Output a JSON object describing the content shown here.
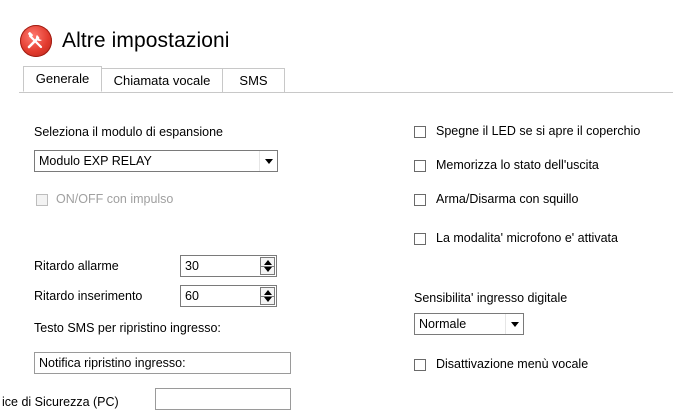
{
  "window": {
    "title": "Altre impostazioni",
    "icon": "tools-icon",
    "icon_color": "#e23b2e"
  },
  "tabs": [
    {
      "label": "Generale",
      "active": true
    },
    {
      "label": "Chiamata vocale",
      "active": false
    },
    {
      "label": "SMS",
      "active": false
    }
  ],
  "left": {
    "expansion_label": "Seleziona il modulo di espansione",
    "expansion_value": "Modulo EXP RELAY",
    "impulse_label": "ON/OFF con impulso",
    "impulse_checked": false,
    "impulse_enabled": false,
    "alarm_delay_label": "Ritardo allarme",
    "alarm_delay_value": "30",
    "arm_delay_label": "Ritardo inserimento",
    "arm_delay_value": "60",
    "sms_restore_label": "Testo SMS per ripristino ingresso:",
    "sms_restore_value": "Notifica ripristino ingresso:",
    "pc_code_label": "ice di Sicurezza (PC)",
    "pc_code_value": ""
  },
  "right": {
    "checkboxes": [
      {
        "label": "Spegne il LED se si apre il coperchio",
        "checked": false
      },
      {
        "label": "Memorizza lo stato dell'uscita",
        "checked": false
      },
      {
        "label": "Arma/Disarma con squillo",
        "checked": false
      },
      {
        "label": "La modalita' microfono e' attivata",
        "checked": false
      }
    ],
    "sensitivity_label": "Sensibilita' ingresso digitale",
    "sensitivity_value": "Normale",
    "voice_menu_label": "Disattivazione menù vocale",
    "voice_menu_checked": false
  }
}
